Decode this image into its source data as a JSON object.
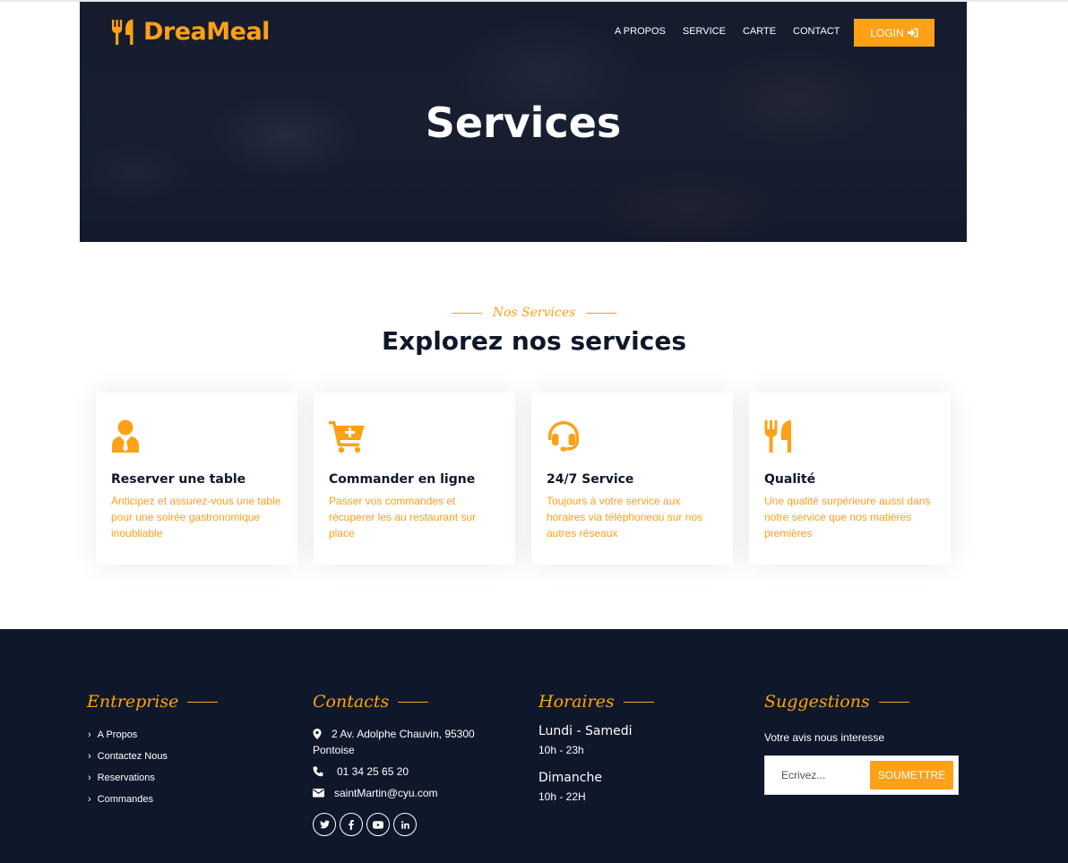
{
  "colors": {
    "accent": "#FEA116",
    "dark": "#0F172B"
  },
  "brand": {
    "name": "DreaMeal",
    "icon": "utensils-icon"
  },
  "nav": {
    "items": [
      "A PROPOS",
      "SERVICE",
      "CARTE",
      "CONTACT"
    ],
    "login_label": "LOGIN",
    "login_icon": "sign-in-icon"
  },
  "hero": {
    "title": "Services"
  },
  "services_section": {
    "eyebrow": "Nos Services",
    "title": "Explorez nos services",
    "cards": [
      {
        "icon": "user-tie-icon",
        "title": "Reserver une table",
        "description": "Anticipez et assurez-vous une table pour une soirée gastronomique inoubliable"
      },
      {
        "icon": "cart-plus-icon",
        "title": "Commander en ligne",
        "description": "Passer vos commandes et récuperer les au restaurant sur place"
      },
      {
        "icon": "headset-icon",
        "title": "24/7 Service",
        "description": "Toujours à votre service aux horaires via téléphoneou sur nos autres réseaux"
      },
      {
        "icon": "utensils-icon",
        "title": "Qualité",
        "description": "Une qualité surpérieure aussi dans notre service que nos matières premières"
      }
    ]
  },
  "footer": {
    "entreprise": {
      "title": "Entreprise",
      "links": [
        "A Propos",
        "Contactez Nous",
        "Reservations",
        "Commandes"
      ]
    },
    "contacts": {
      "title": "Contacts",
      "address": "2 Av. Adolphe Chauvin, 95300 Pontoise",
      "phone": "01 34 25 65 20",
      "email": "saintMartin@cyu.com",
      "socials": [
        "twitter-icon",
        "facebook-icon",
        "youtube-icon",
        "linkedin-icon"
      ]
    },
    "horaires": {
      "title": "Horaires",
      "schedule": [
        {
          "days": "Lundi - Samedi",
          "hours": "10h - 23h"
        },
        {
          "days": "Dimanche",
          "hours": "10h - 22H"
        }
      ]
    },
    "suggestions": {
      "title": "Suggestions",
      "text": "Votre avis nous interesse",
      "placeholder": "Ecrivez...",
      "submit_label": "SOUMETTRE"
    }
  }
}
